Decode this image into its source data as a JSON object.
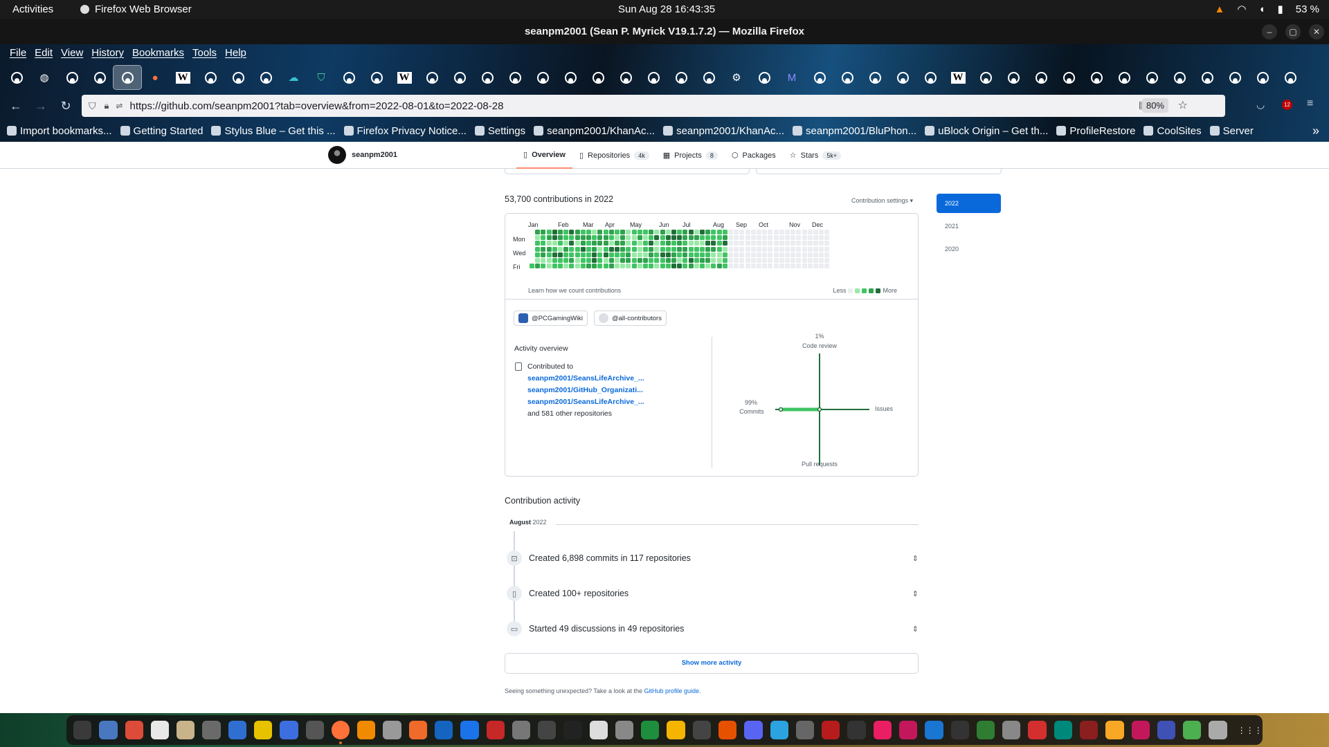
{
  "system": {
    "activities": "Activities",
    "app_name": "Firefox Web Browser",
    "clock": "Sun Aug 28  16:43:35",
    "battery": "53 %"
  },
  "window": {
    "title": "seanpm2001 (Sean P. Myrick V19.1.7.2) — Mozilla Firefox"
  },
  "menu": [
    "File",
    "Edit",
    "View",
    "History",
    "Bookmarks",
    "Tools",
    "Help"
  ],
  "tabs": {
    "count": 47,
    "active_index": 4,
    "icons": [
      "github",
      "globe",
      "github",
      "github",
      "github",
      "firefox",
      "wikipedia",
      "github",
      "github",
      "github",
      "cloud",
      "shield",
      "github",
      "github",
      "wikipedia",
      "github",
      "github",
      "github",
      "github",
      "github",
      "github",
      "github",
      "github",
      "github",
      "github",
      "github",
      "settings",
      "github",
      "mastodon",
      "github",
      "github",
      "github",
      "github",
      "github",
      "wikipedia",
      "github",
      "github",
      "github",
      "github",
      "github",
      "github",
      "github",
      "github",
      "github",
      "github",
      "github",
      "github"
    ]
  },
  "urlbar": {
    "url": "https://github.com/seanpm2001?tab=overview&from=2022-08-01&to=2022-08-28",
    "zoom": "80%",
    "extension_badge": "12"
  },
  "bookmarks": [
    "Import bookmarks...",
    "Getting Started",
    "Stylus Blue – Get this ...",
    "Firefox Privacy Notice...",
    "Settings",
    "seanpm2001/KhanAc...",
    "seanpm2001/KhanAc...",
    "seanpm2001/BluPhon...",
    "uBlock Origin – Get th...",
    "ProfileRestore",
    "CoolSites",
    "Server"
  ],
  "github": {
    "username": "seanpm2001",
    "nav": [
      {
        "label": "Overview",
        "count": ""
      },
      {
        "label": "Repositories",
        "count": "4k"
      },
      {
        "label": "Projects",
        "count": "8"
      },
      {
        "label": "Packages",
        "count": ""
      },
      {
        "label": "Stars",
        "count": "5k+"
      }
    ],
    "contrib_title": "53,700 contributions in 2022",
    "contrib_settings": "Contribution settings ▾",
    "months": [
      "Jan",
      "Feb",
      "Mar",
      "Apr",
      "May",
      "Jun",
      "Jul",
      "Aug",
      "Sep",
      "Oct",
      "Nov",
      "Dec"
    ],
    "days": [
      "Mon",
      "Wed",
      "Fri"
    ],
    "learn": "Learn how we count contributions",
    "less": "Less",
    "more": "More",
    "level_colors": [
      "#ebedf0",
      "#9be9a8",
      "#40c463",
      "#30a14e",
      "#216e39"
    ],
    "orgs": [
      "@PCGamingWiki",
      "@all-contributors"
    ],
    "activity_overview": "Activity overview",
    "contributed_to": "Contributed to",
    "repos": [
      "seanpm2001/SeansLifeArchive_...",
      "seanpm2001/GitHub_Organizati...",
      "seanpm2001/SeansLifeArchive_..."
    ],
    "other_repos": "and 581 other repositories",
    "axes": {
      "code_review_pct": "1%",
      "code_review": "Code review",
      "commits_pct": "99%",
      "commits": "Commits",
      "issues": "Issues",
      "pull_requests": "Pull requests"
    },
    "contribution_activity": "Contribution activity",
    "month_label": "August",
    "month_year": "2022",
    "activity_items": [
      "Created 6,898 commits in 117 repositories",
      "Created 100+ repositories",
      "Started 49 discussions in 49 repositories"
    ],
    "show_more": "Show more activity",
    "footer_text": "Seeing something unexpected? Take a look at the",
    "footer_link": "GitHub profile guide.",
    "years": [
      "2022",
      "2021",
      "2020"
    ]
  }
}
